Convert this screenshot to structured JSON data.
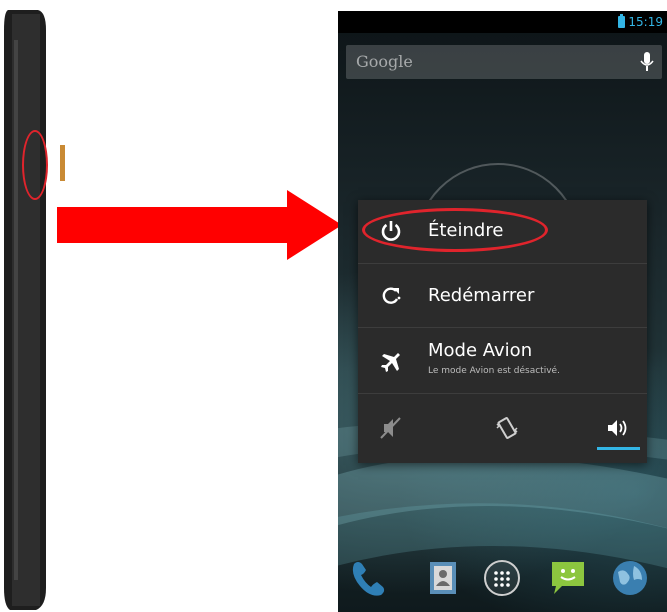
{
  "status_bar": {
    "time": "15:19"
  },
  "search": {
    "placeholder": "Google"
  },
  "power_menu": {
    "items": [
      {
        "label": "Éteindre",
        "icon": "power-icon"
      },
      {
        "label": "Redémarrer",
        "icon": "restart-icon"
      },
      {
        "label": "Mode Avion",
        "sublabel": "Le mode Avion est désactivé.",
        "icon": "airplane-icon"
      }
    ],
    "sound_modes": [
      {
        "icon": "mute-icon",
        "selected": false
      },
      {
        "icon": "vibrate-icon",
        "selected": false
      },
      {
        "icon": "volume-icon",
        "selected": true
      }
    ]
  },
  "dock": [
    "phone-icon",
    "contacts-icon",
    "apps-icon",
    "messages-icon",
    "browser-icon"
  ],
  "colors": {
    "accent": "#33b5e5",
    "highlight": "#e0242c",
    "arrow": "#ff0000",
    "menu_bg": "#2b2b2b"
  }
}
